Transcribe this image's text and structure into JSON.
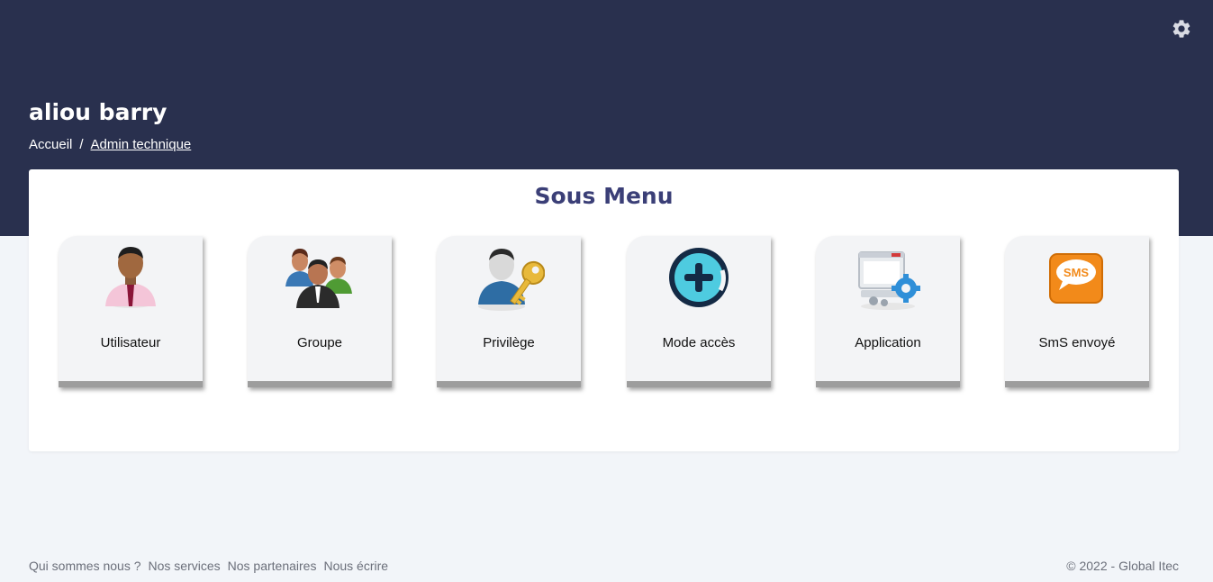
{
  "header": {
    "user_name": "aliou barry",
    "breadcrumb": [
      {
        "label": "Accueil"
      },
      {
        "separator": "/"
      },
      {
        "label": "Admin technique"
      }
    ]
  },
  "panel": {
    "title": "Sous Menu",
    "tiles": [
      {
        "label": "Utilisateur",
        "icon": "user-icon"
      },
      {
        "label": "Groupe",
        "icon": "group-icon"
      },
      {
        "label": "Privilège",
        "icon": "privilege-key-icon"
      },
      {
        "label": "Mode accès",
        "icon": "plus-circle-icon"
      },
      {
        "label": "Application",
        "icon": "application-gear-icon"
      },
      {
        "label": "SmS envoyé",
        "icon": "sms-bubble-icon"
      }
    ]
  },
  "footer": {
    "links": [
      "Qui sommes nous ?",
      "Nos services",
      "Nos partenaires",
      "Nous écrire"
    ],
    "copyright": "© 2022 - Global Itec"
  },
  "colors": {
    "header_bg": "#29304e",
    "page_bg": "#f2f5f9",
    "title_accent": "#3b3f77",
    "tile_bg": "#f3f4f6"
  }
}
